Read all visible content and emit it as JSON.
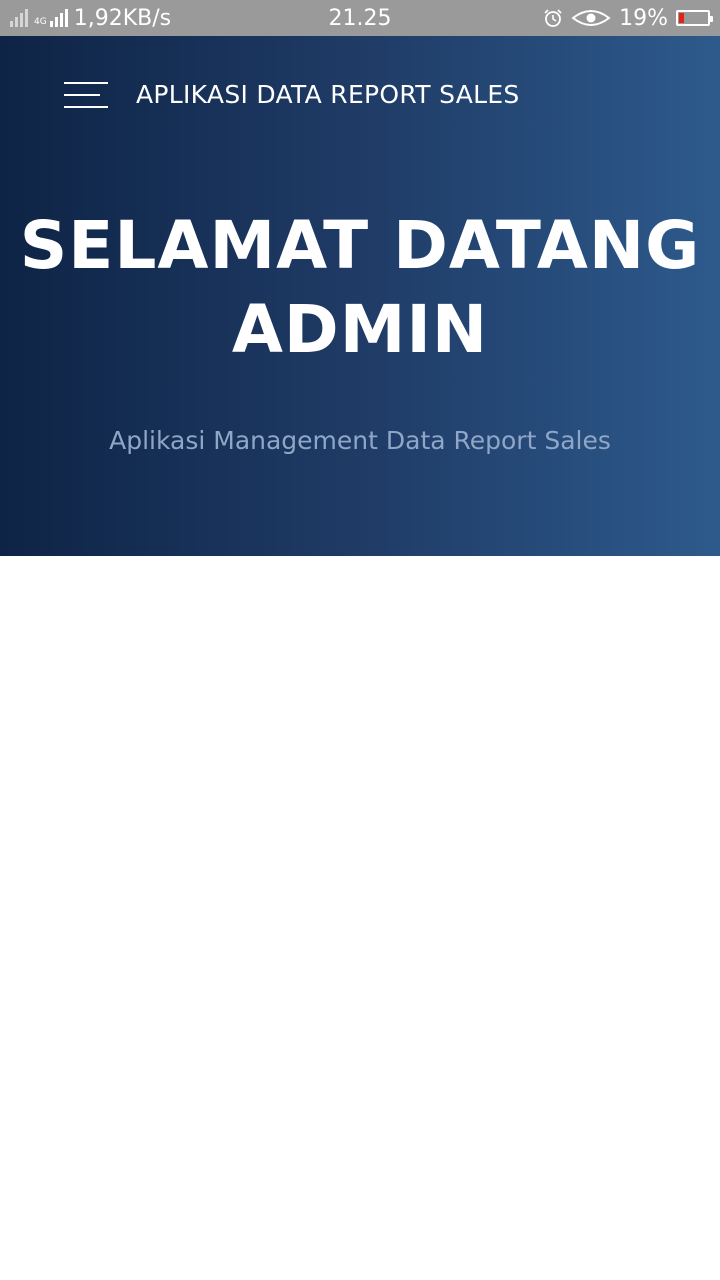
{
  "status_bar": {
    "network_speed": "1,92KB/s",
    "network_type": "4G",
    "time": "21.25",
    "battery_percent": "19%",
    "battery_level": 0.19,
    "icons": [
      "signal-icon",
      "mobile-data-icon",
      "alarm-icon",
      "eye-comfort-icon",
      "battery-icon"
    ]
  },
  "header": {
    "app_title": "APLIKASI DATA REPORT SALES",
    "menu_icon": "hamburger-menu-icon"
  },
  "hero": {
    "headline_line1": "SELAMAT DATANG",
    "headline_line2": "ADMIN",
    "subtitle": "Aplikasi Management Data Report Sales",
    "colors": {
      "gradient_start": "#0e2446",
      "gradient_end": "#2d5a8c",
      "subtitle": "#8fa6c6"
    }
  }
}
